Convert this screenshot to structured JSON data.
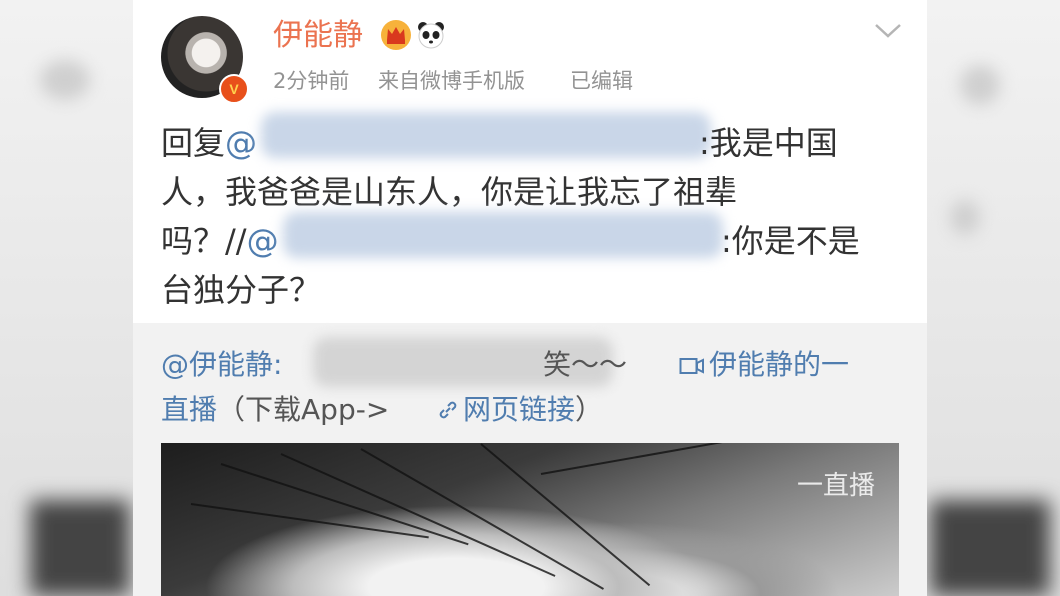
{
  "post": {
    "username": "伊能静",
    "time": "2分钟前",
    "source": "来自微博手机版",
    "edited": "已编辑",
    "icons": [
      "crown-icon",
      "panda-icon",
      "chevron-down-icon",
      "verified-badge"
    ],
    "line1_prefix": "回复",
    "line1_at": "@",
    "line1_suffix": ":我是中国",
    "line2": "人，我爸爸是山东人，你是让我忘了祖辈",
    "line3_prefix": "吗？//",
    "line3_at": "@",
    "line3_suffix": ":你是不是",
    "line4": "台独分子？"
  },
  "repost": {
    "mention": "@伊能静:",
    "tail": "笑～～",
    "live_link": "伊能静的一",
    "line2_a": "直播",
    "line2_b": "（下载App->",
    "web_link": "网页链接",
    "line2_close": "）",
    "watermark": "一直播"
  },
  "colors": {
    "username": "#eb7350",
    "link": "#507daf",
    "meta": "#939393",
    "body": "#333333",
    "repost_bg": "#f2f2f2"
  }
}
